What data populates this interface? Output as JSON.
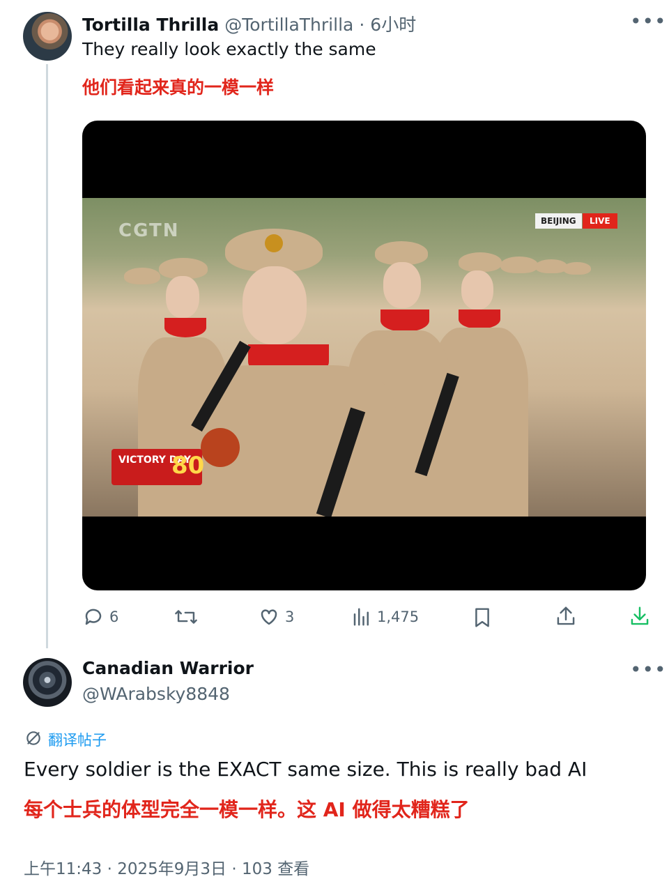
{
  "post1": {
    "name": "Tortilla Thrilla",
    "handle": "@TortillaThrilla",
    "separator": "·",
    "time": "6小时",
    "text_en": "They really look exactly the same",
    "text_zh": "他们看起来真的一模一样",
    "video": {
      "watermark": "CGTN",
      "location_tag": "BEIJING",
      "live_tag": "LIVE",
      "overlay_text": "VICTORY DAY",
      "overlay_number": "80"
    },
    "actions": {
      "replies": "6",
      "reposts": "",
      "likes": "3",
      "views": "1,475"
    }
  },
  "post2": {
    "name": "Canadian Warrior",
    "handle": "@WArabsky8848",
    "translate_label": "翻译帖子",
    "text_en": "Every soldier is the EXACT same size. This is really bad AI",
    "text_zh": "每个士兵的体型完全一模一样。这 AI 做得太糟糕了",
    "meta": "上午11:43 · 2025年9月3日 · 103 查看"
  },
  "icons": {
    "reply": "reply-icon",
    "repost": "repost-icon",
    "like": "heart-icon",
    "views": "views-icon",
    "bookmark": "bookmark-icon",
    "share": "share-icon",
    "download": "download-icon",
    "more": "more-icon",
    "translate": "translate-icon"
  },
  "colors": {
    "accent": "#1d9bf0",
    "chinese_text": "#e1251b",
    "muted": "#536471",
    "download": "#17bf63"
  }
}
